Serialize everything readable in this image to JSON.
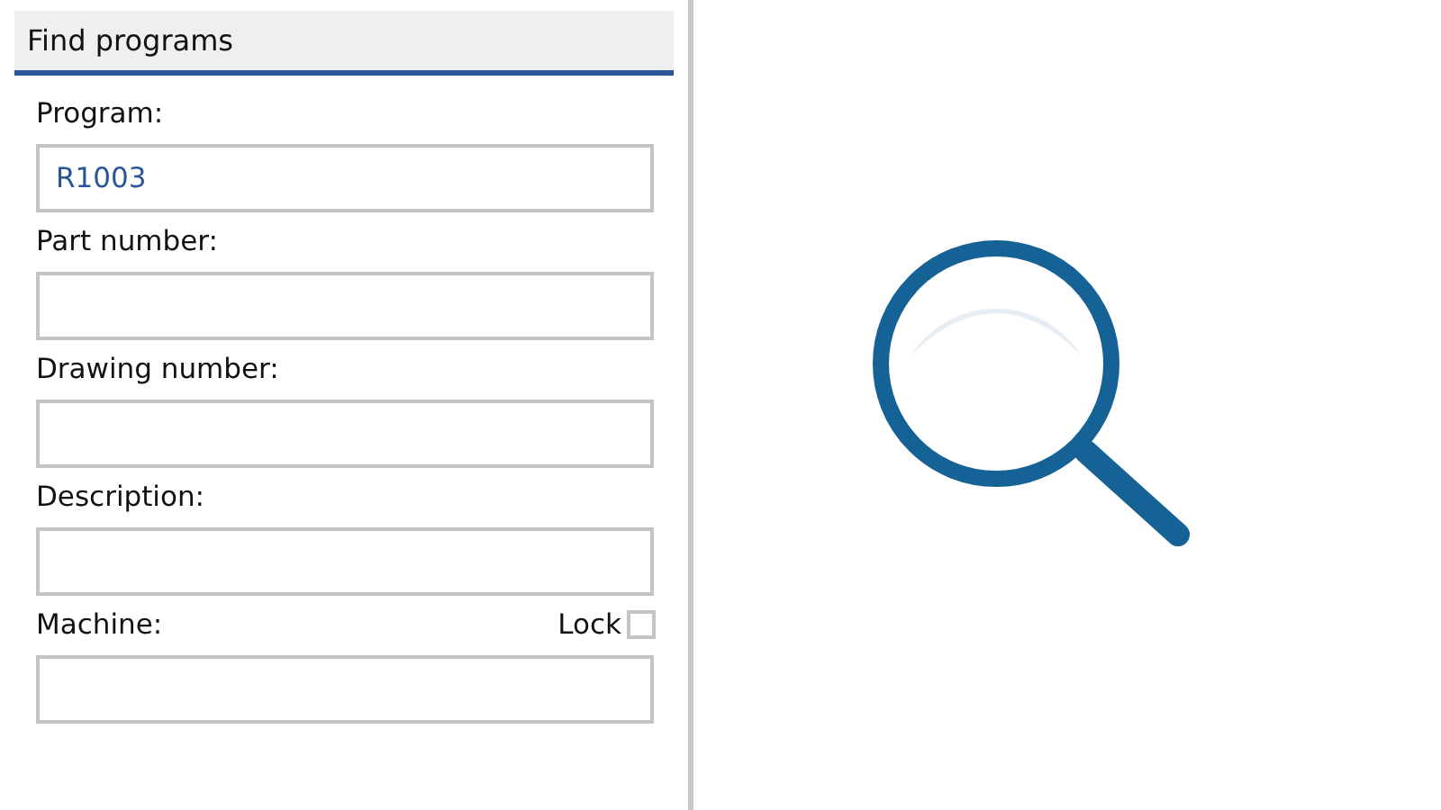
{
  "panel": {
    "title": "Find programs"
  },
  "fields": [
    {
      "label": "Program:",
      "value": "R1003"
    },
    {
      "label": "Part number:"
    },
    {
      "label": "Drawing number:"
    },
    {
      "label": "Description:"
    },
    {
      "label": "Machine:",
      "lock": {
        "label": "Lock",
        "checked": false
      }
    }
  ]
}
